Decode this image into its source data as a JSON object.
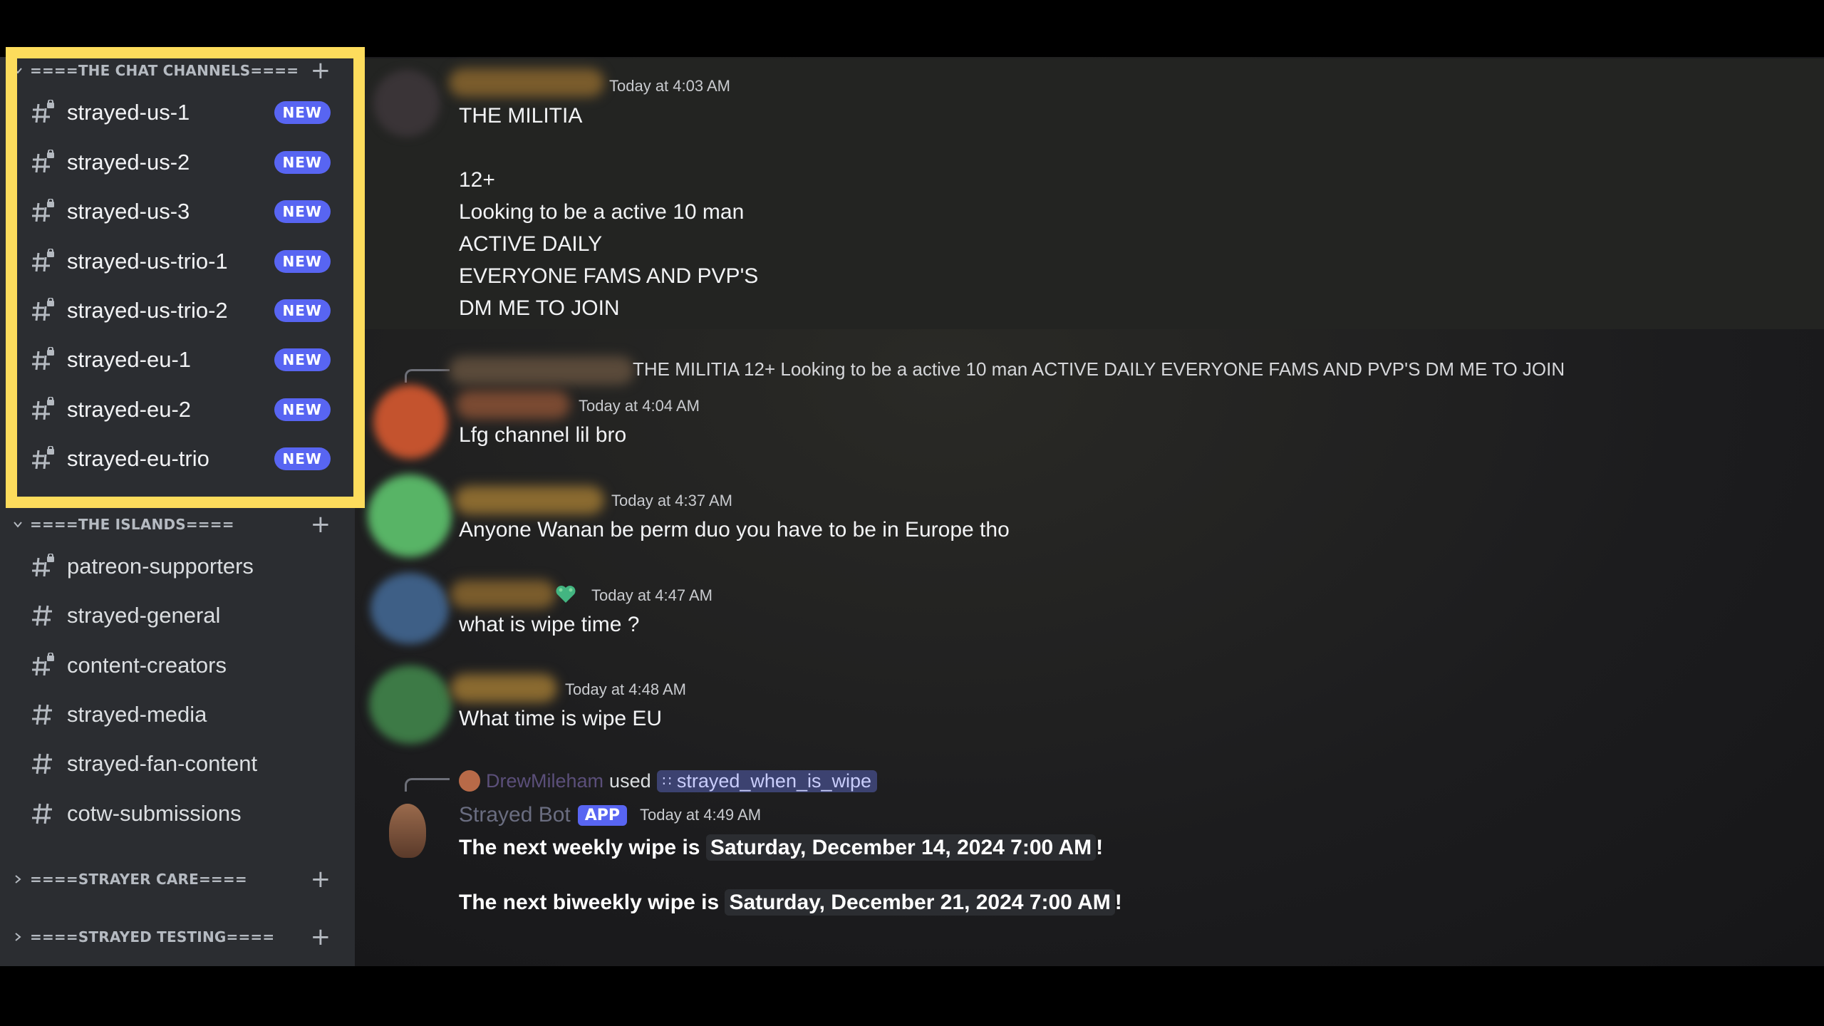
{
  "colors": {
    "highlight": "#fddc5c",
    "new_badge": "#5865f2",
    "sidebar_bg": "#2b2d31",
    "chat_bg": "#1e1f22"
  },
  "sidebar": {
    "categories": [
      {
        "label": "====THE CHAT CHANNELS====",
        "expanded": true,
        "channels": [
          {
            "name": "strayed-us-1",
            "badge": "NEW",
            "icon": "hashtag-lock-icon"
          },
          {
            "name": "strayed-us-2",
            "badge": "NEW",
            "icon": "hashtag-lock-icon"
          },
          {
            "name": "strayed-us-3",
            "badge": "NEW",
            "icon": "hashtag-lock-icon"
          },
          {
            "name": "strayed-us-trio-1",
            "badge": "NEW",
            "icon": "hashtag-lock-icon"
          },
          {
            "name": "strayed-us-trio-2",
            "badge": "NEW",
            "icon": "hashtag-lock-icon"
          },
          {
            "name": "strayed-eu-1",
            "badge": "NEW",
            "icon": "hashtag-lock-icon"
          },
          {
            "name": "strayed-eu-2",
            "badge": "NEW",
            "icon": "hashtag-lock-icon"
          },
          {
            "name": "strayed-eu-trio",
            "badge": "NEW",
            "icon": "hashtag-lock-icon"
          }
        ]
      },
      {
        "label": "====THE ISLANDS====",
        "expanded": true,
        "channels": [
          {
            "name": "patreon-supporters",
            "icon": "hashtag-lock-icon"
          },
          {
            "name": "strayed-general",
            "icon": "hashtag-icon"
          },
          {
            "name": "content-creators",
            "icon": "hashtag-lock-icon"
          },
          {
            "name": "strayed-media",
            "icon": "hashtag-icon"
          },
          {
            "name": "strayed-fan-content",
            "icon": "hashtag-icon"
          },
          {
            "name": "cotw-submissions",
            "icon": "hashtag-icon"
          }
        ]
      },
      {
        "label": "====STRAYER CARE====",
        "expanded": false,
        "channels": []
      },
      {
        "label": "====STRAYED TESTING====",
        "expanded": false,
        "channels": []
      }
    ]
  },
  "messages": {
    "m1": {
      "timestamp": "Today at 4:03 AM",
      "lines": [
        "THE MILITIA",
        "",
        "12+",
        "Looking to be a active 10 man",
        "ACTIVE DAILY",
        "EVERYONE FAMS AND PVP'S",
        "DM ME TO JOIN"
      ]
    },
    "m2": {
      "reply_preview": "THE MILITIA   12+  Looking to be a active 10 man  ACTIVE DAILY  EVERYONE FAMS AND PVP'S  DM ME TO JOIN",
      "timestamp": "Today at 4:04 AM",
      "text": "Lfg channel lil bro"
    },
    "m3": {
      "timestamp": "Today at 4:37 AM",
      "text": "Anyone Wanan be perm duo you have to be in Europe tho"
    },
    "m4": {
      "timestamp": "Today at 4:47 AM",
      "text": "what is wipe time ?"
    },
    "m5": {
      "timestamp": "Today at 4:48 AM",
      "text": "What time is wipe EU"
    },
    "m6": {
      "invoker": "DrewMileham",
      "used": "used",
      "command": "strayed_when_is_wipe",
      "author": "Strayed Bot",
      "app_tag": "APP",
      "timestamp": "Today at 4:49 AM",
      "line1_prefix": "The next weekly wipe is ",
      "line1_date": "Saturday, December 14, 2024 7:00 AM",
      "line1_suffix": "!",
      "line2_prefix": "The next biweekly wipe is ",
      "line2_date": "Saturday, December 21, 2024 7:00 AM",
      "line2_suffix": "!"
    }
  }
}
